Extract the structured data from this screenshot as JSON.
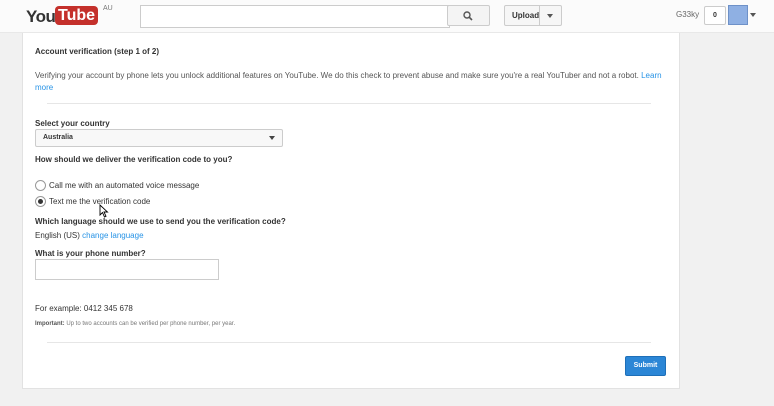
{
  "header": {
    "logo_you": "You",
    "logo_tube": "Tube",
    "logo_region": "AU",
    "search": {
      "value": "",
      "placeholder": ""
    },
    "search_icon": "search-icon",
    "upload_label": "Upload",
    "username": "G33ky",
    "notification_count": "0"
  },
  "form": {
    "title": "Account verification (step 1 of 2)",
    "intro": "Verifying your account by phone lets you unlock additional features on YouTube. We do this check to prevent abuse and make sure you're a real YouTuber and not a robot.",
    "learn_more": "Learn more",
    "country_label": "Select your country",
    "country_value": "Australia",
    "delivery_label": "How should we deliver the verification code to you?",
    "delivery_options": [
      {
        "label": "Call me with an automated voice message",
        "selected": false
      },
      {
        "label": "Text me the verification code",
        "selected": true
      }
    ],
    "language_label": "Which language should we use to send you the verification code?",
    "language_value": "English (US)",
    "change_language": "change language",
    "phone_label": "What is your phone number?",
    "phone_value": "",
    "example": "For example: 0412 345 678",
    "important_label": "Important:",
    "important_text": "Up to two accounts can be verified per phone number, per year.",
    "submit_label": "Submit"
  },
  "colors": {
    "brand_red": "#c4302b",
    "link_blue": "#2793e6",
    "submit_blue": "#2b86d6"
  }
}
